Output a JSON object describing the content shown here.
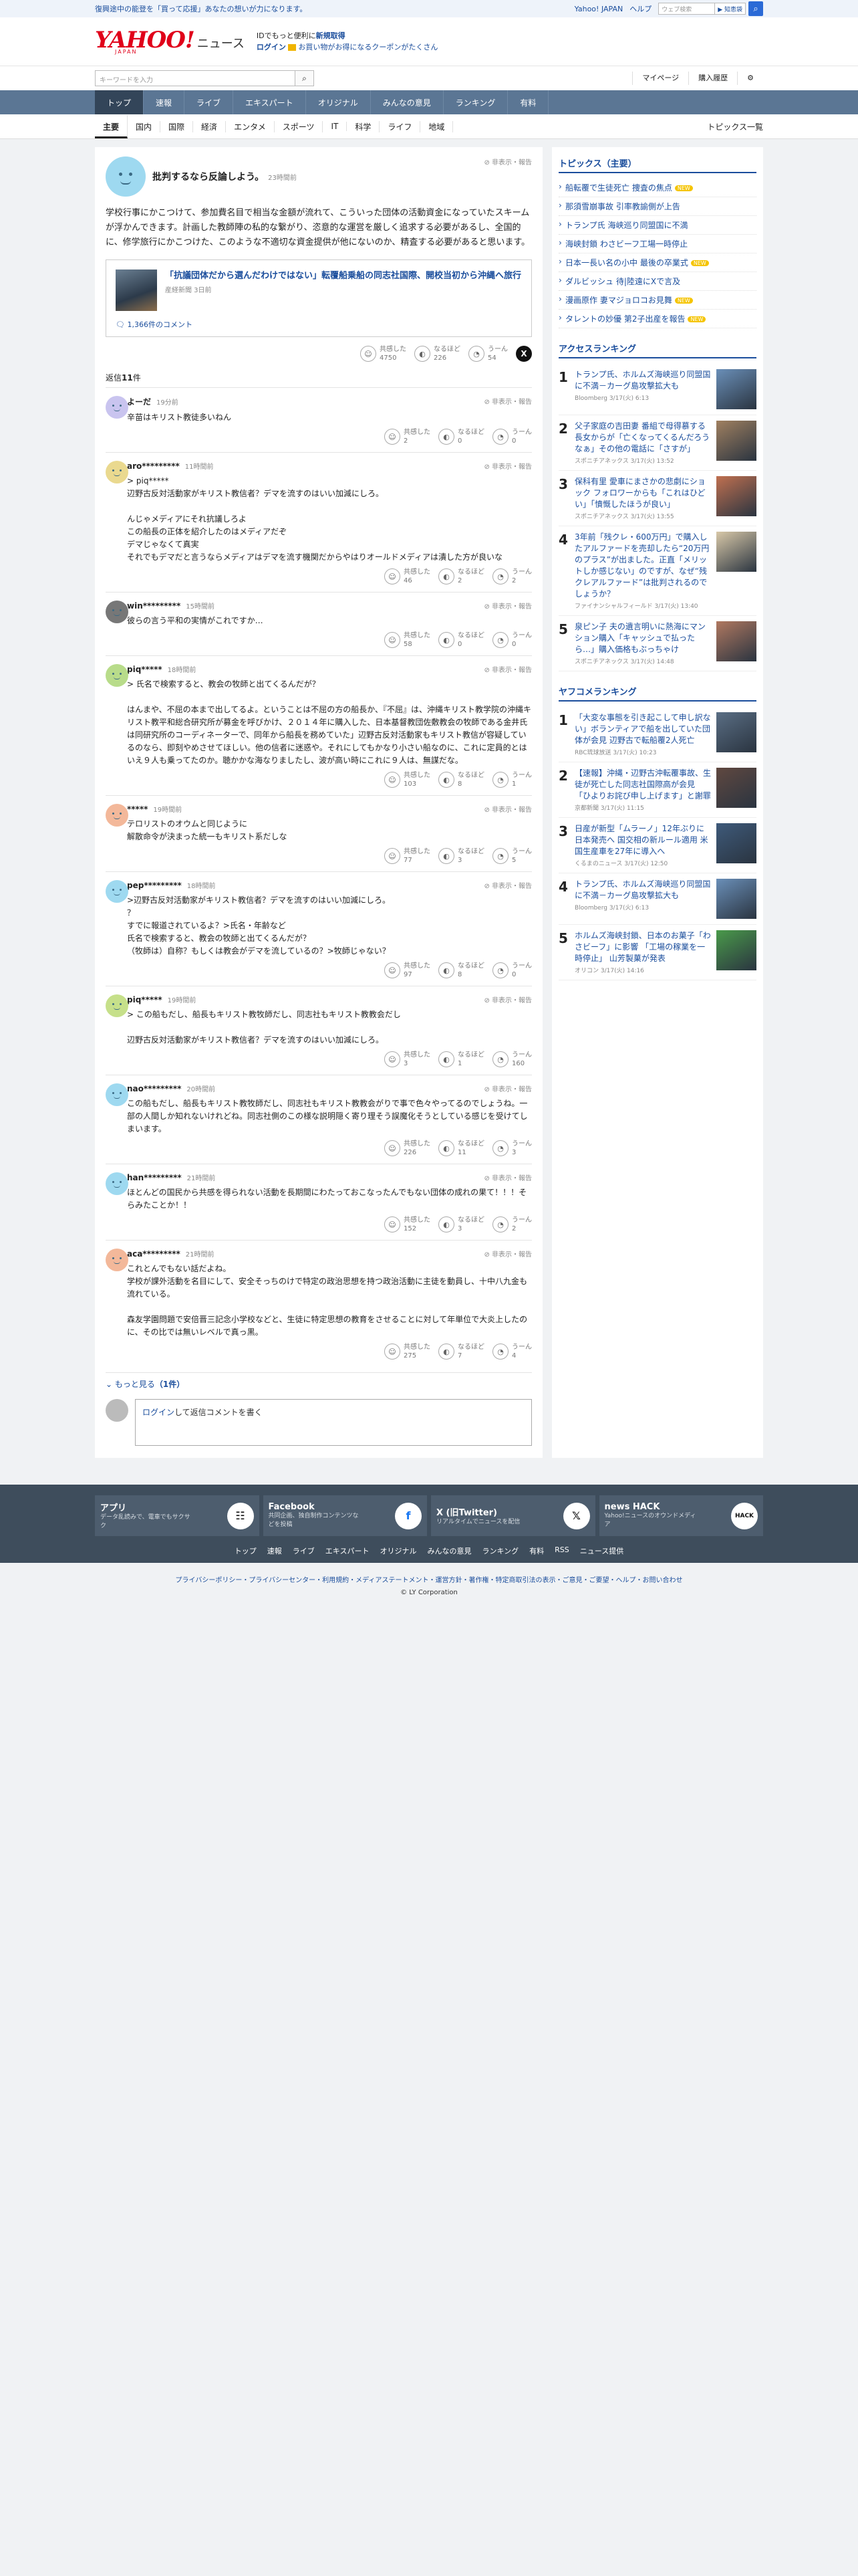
{
  "promo": {
    "text": "復興途中の能登を「買って応援」あなたの想いが力になります。"
  },
  "toplinks": {
    "yahoo": "Yahoo! JAPAN",
    "help": "ヘルプ",
    "search_placeholder": "ウェブ検索",
    "search_button": "▶ 知恵袋"
  },
  "header": {
    "logo": "YAHOO!",
    "logo_sub": "JAPAN",
    "news": "ニュース",
    "line1_prefix": "IDでもっと便利に",
    "line1_link": "新規取得",
    "login": "ログイン",
    "line2": "お買い物がお得になるクーポンがたくさん"
  },
  "subheader": {
    "keyword_placeholder": "キーワードを入力",
    "mypage": "マイページ",
    "history": "購入履歴"
  },
  "nav": [
    "トップ",
    "速報",
    "ライブ",
    "エキスパート",
    "オリジナル",
    "みんなの意見",
    "ランキング",
    "有料"
  ],
  "categories": [
    "主要",
    "国内",
    "国際",
    "経済",
    "エンタメ",
    "スポーツ",
    "IT",
    "科学",
    "ライフ",
    "地域"
  ],
  "topics_list_link": "トピックス一覧",
  "opinion": {
    "title": "批判するなら反論しよう。",
    "time": "23時間前",
    "report": "非表示・報告",
    "body": "学校行事にかこつけて、参加費名目で相当な金額が流れて、こういった団体の活動資金になっていたスキームが浮かんできます。計画した教師陣の私的な繋がり、恣意的な運営を厳しく追求する必要があるし、全国的に、修学旅行にかこつけた、このような不適切な資金提供が他にないのか、精査する必要があると思います。",
    "article_title": "「抗議団体だから選んだわけではない」転覆船乗船の同志社国際、開校当初から沖縄へ旅行",
    "article_source": "産経新聞 3日前",
    "comments_link": "1,366件のコメント",
    "reactions": {
      "agree_label": "共感した",
      "agree": "4750",
      "useful_label": "なるほど",
      "useful": "226",
      "hmm_label": "うーん",
      "hmm": "54"
    }
  },
  "reply_header": {
    "label": "返信",
    "count": "11",
    "unit": "件"
  },
  "replies": [
    {
      "name": "よーだ",
      "time": "19分前",
      "text": "辛苗はキリスト教徒多いねん",
      "agree": "2",
      "useful": "0",
      "hmm": "0",
      "color": "#c9c4ef"
    },
    {
      "name": "aro*********",
      "time": "11時間前",
      "text": "> piq*****\n辺野古反対活動家がキリスト教信者？デマを流すのはいい加減にしろ。\n\nんじゃメディアにそれ抗議しろよ\nこの船長の正体を紹介したのはメディアだぞ\nデマじゃなくて真実\nそれでもデマだと言うならメディアはデマを流す機関だからやはりオールドメディアは潰した方が良いな",
      "agree": "46",
      "useful": "2",
      "hmm": "2",
      "color": "#ead98f"
    },
    {
      "name": "win*********",
      "time": "15時間前",
      "text": "彼らの言う平和の実情がこれですか…",
      "agree": "58",
      "useful": "0",
      "hmm": "0",
      "color": "#777777"
    },
    {
      "name": "piq*****",
      "time": "18時間前",
      "text": "> 氏名で検索すると、教会の牧師と出てくるんだが？\n\nはんまや、不屈の本まで出してるよ。ということは不屈の方の船長か、『不屈』は、沖縄キリスト教学院の沖縄キリスト教平和総合研究所が募金を呼びかけ、２０１４年に購入した、日本基督教団佐敷教会の牧師である金井氏は同研究所のコーディネーターで、同年から船長を務めていた」辺野古反対活動家もキリスト教信が容疑しているのなら、即刻やめさせてほしい。他の信者に迷惑や。それにしてもかなり小さい船なのに、これに定員的とはいえ９人も乗ってたのか。聴かかな海なりましたし、波が高い時にこれに９人は、無謀だな。",
      "agree": "103",
      "useful": "8",
      "hmm": "1",
      "color": "#b8dc8a"
    },
    {
      "name": "*****",
      "time": "19時間前",
      "text": "テロリストのオウムと同じように\n解散命令が決まった統一もキリスト系だしな",
      "agree": "77",
      "useful": "3",
      "hmm": "5",
      "color": "#f3b89a"
    },
    {
      "name": "pep*********",
      "time": "18時間前",
      "text": ">辺野古反対活動家がキリスト教信者？デマを流すのはいい加減にしろ。\n？\nすでに報道されているよ？>氏名・年齢など\n氏名で検索すると、教会の牧師と出てくるんだが？\n（牧師は）自称？もしくは教会がデマを流しているの？>牧師じゃない？",
      "agree": "97",
      "useful": "8",
      "hmm": "0",
      "color": "#9ed9f0"
    },
    {
      "name": "piq*****",
      "time": "19時間前",
      "text": "> この船もだし、船長もキリスト教牧師だし、同志社もキリスト教教会だし\n\n辺野古反対活動家がキリスト教信者？デマを流すのはいい加減にしろ。",
      "agree": "3",
      "useful": "1",
      "hmm": "160",
      "color": "#c6e08a"
    },
    {
      "name": "nao*********",
      "time": "20時間前",
      "text": "この船もだし、船長もキリスト教牧師だし、同志社もキリスト教教会がりで事で色々やってるのでしょうね。一部の人間しか知れないけれどね。同志社側のこの様な説明隠く寄り理そう誤魔化そうとしている感じを受けてしまいます。",
      "agree": "226",
      "useful": "11",
      "hmm": "3",
      "color": "#9ed9f0"
    },
    {
      "name": "han*********",
      "time": "21時間前",
      "text": "ほとんどの国民から共感を得られない活動を長期間にわたっておこなったんでもない団体の成れの果て！！！そらみたことか！！",
      "agree": "152",
      "useful": "3",
      "hmm": "2",
      "color": "#9ed9f0"
    },
    {
      "name": "aca*********",
      "time": "21時間前",
      "text": "これとんでもない話だよね。\n学校が課外活動を名目にして、安全そっちのけで特定の政治思想を持つ政治活動に主徒を動員し、十中八九金も流れている。\n\n森友学園問題で安倍晋三記念小学校などと、生徒に特定思想の教育をさせることに対して年単位で大炎上したのに、その比では無いレベルで真っ黒。",
      "agree": "275",
      "useful": "7",
      "hmm": "4",
      "color": "#f3b89a"
    }
  ],
  "more": {
    "label": "もっと見る",
    "count": "（1件）"
  },
  "login_prompt": {
    "link": "ログイン",
    "text": "して返信コメントを書く"
  },
  "side": {
    "topics_title": "トピックス（主要）",
    "topics": [
      {
        "text": "船転覆で生徒死亡 捜査の焦点",
        "new": "NEW"
      },
      {
        "text": "那須雪崩事故 引率教諭側が上告",
        "new": ""
      },
      {
        "text": "トランプ氏 海峡巡り同盟国に不満",
        "new": ""
      },
      {
        "text": "海峡封鎖 わさビーフ工場一時停止",
        "new": ""
      },
      {
        "text": "日本一長い名の小中 最後の卒業式",
        "new": "NEW"
      },
      {
        "text": "ダルビッシュ 待|陸遠にXで言及",
        "new": ""
      },
      {
        "text": "漫画原作 妻マジョロコお見舞",
        "new": "NEW"
      },
      {
        "text": "タレントの妙優 第2子出産を報告",
        "new": "NEW"
      }
    ],
    "access_title": "アクセスランキング",
    "access": [
      {
        "n": "1",
        "t": "トランプ氏、ホルムズ海峡巡り同盟国に不満－カーグ島攻撃拡大も",
        "s": "Bloomberg 3/17(火) 6:13",
        "c": "#6a8fb8"
      },
      {
        "n": "2",
        "t": "父子家庭の吉田妻 番組で母得慕する長女からが「亡くなってくるんだろうなぁ」その他の電話に「さすが」",
        "s": "スポニチアネックス 3/17(火) 13:52",
        "c": "#a08060"
      },
      {
        "n": "3",
        "t": "保科有里 愛車にまさかの悲劇にショック フォロワーからも「これはひどい」「憤慨したほうが良い」",
        "s": "スポニチアネックス 3/17(火) 13:55",
        "c": "#c07050"
      },
      {
        "n": "4",
        "t": "3年前「残クレ・600万円」で購入したアルファードを売却したら“20万円のプラス”が出ました。正直「メリットしか感じない」のですが、なぜ“残クレアルファード”は批判されるのでしょうか？",
        "s": "ファイナンシャルフィールド 3/17(火) 13:40",
        "c": "#d8c8a8"
      },
      {
        "n": "5",
        "t": "泉ピン子 夫の遺言明いに熱海にマンション購入「キャッシュで払ったら…」購入価格もぶっちゃけ",
        "s": "スポニチアネックス 3/17(火) 14:48",
        "c": "#b07860"
      }
    ],
    "yafoo_title": "ヤフコメランキング",
    "yafoo": [
      {
        "n": "1",
        "t": "「大変な事態を引き起こして申し訳ない」ボランティアで船を出していた団体が会見 辺野古で転船覆2人死亡",
        "s": "RBC琉球放送 3/17(火) 10:23",
        "c": "#5a6e84"
      },
      {
        "n": "2",
        "t": "【速報】沖縄・辺野古沖転覆事故、生徒が死亡した同志社国際高が会見 「ひよりお詫び申し上げます」と謝罪",
        "s": "京都新聞 3/17(火) 11:15",
        "c": "#604840"
      },
      {
        "n": "3",
        "t": "日産が新型「ムラーノ」12年ぶりに日本発売へ 国交相の新ルール適用 米国生産車を27年に導入へ",
        "s": "くるまのニュース 3/17(火) 12:50",
        "c": "#3e5a7a"
      },
      {
        "n": "4",
        "t": "トランプ氏、ホルムズ海峡巡り同盟国に不満－カーグ島攻撃拡大も",
        "s": "Bloomberg 3/17(火) 6:13",
        "c": "#6a8fb8"
      },
      {
        "n": "5",
        "t": "ホルムズ海峡封鎖、日本のお菓子「わさビーフ」に影響 「工場の稼業を一時停止」 山芳製菓が発表",
        "s": "オリコン 3/17(火) 14:16",
        "c": "#4a9a4a"
      }
    ]
  },
  "footer": {
    "cards": [
      {
        "h": "アプリ",
        "d": "データ乱読みで、電車でもサクサク",
        "icon": "☷"
      },
      {
        "h": "Facebook",
        "d": "共同企画、独自制作コンテンツなどを投稿",
        "icon": "f"
      },
      {
        "h": "X (旧Twitter)",
        "d": "リアルタイムでニュースを配信",
        "icon": "𝕏"
      },
      {
        "h": "news HACK",
        "d": "Yahoo!ニュースのオウンドメディア",
        "icon": "HACK"
      }
    ],
    "links": [
      "トップ",
      "速報",
      "ライブ",
      "エキスパート",
      "オリジナル",
      "みんなの意見",
      "ランキング",
      "有料",
      "RSS",
      "ニュース提供"
    ],
    "bottom": "プライバシーポリシー・プライバシーセンター・利用規約・メディアステートメント・運営方針・著作権・特定商取引法の表示・ご意見・ご要望・ヘルプ・お問い合わせ",
    "copyright": "© LY Corporation"
  }
}
